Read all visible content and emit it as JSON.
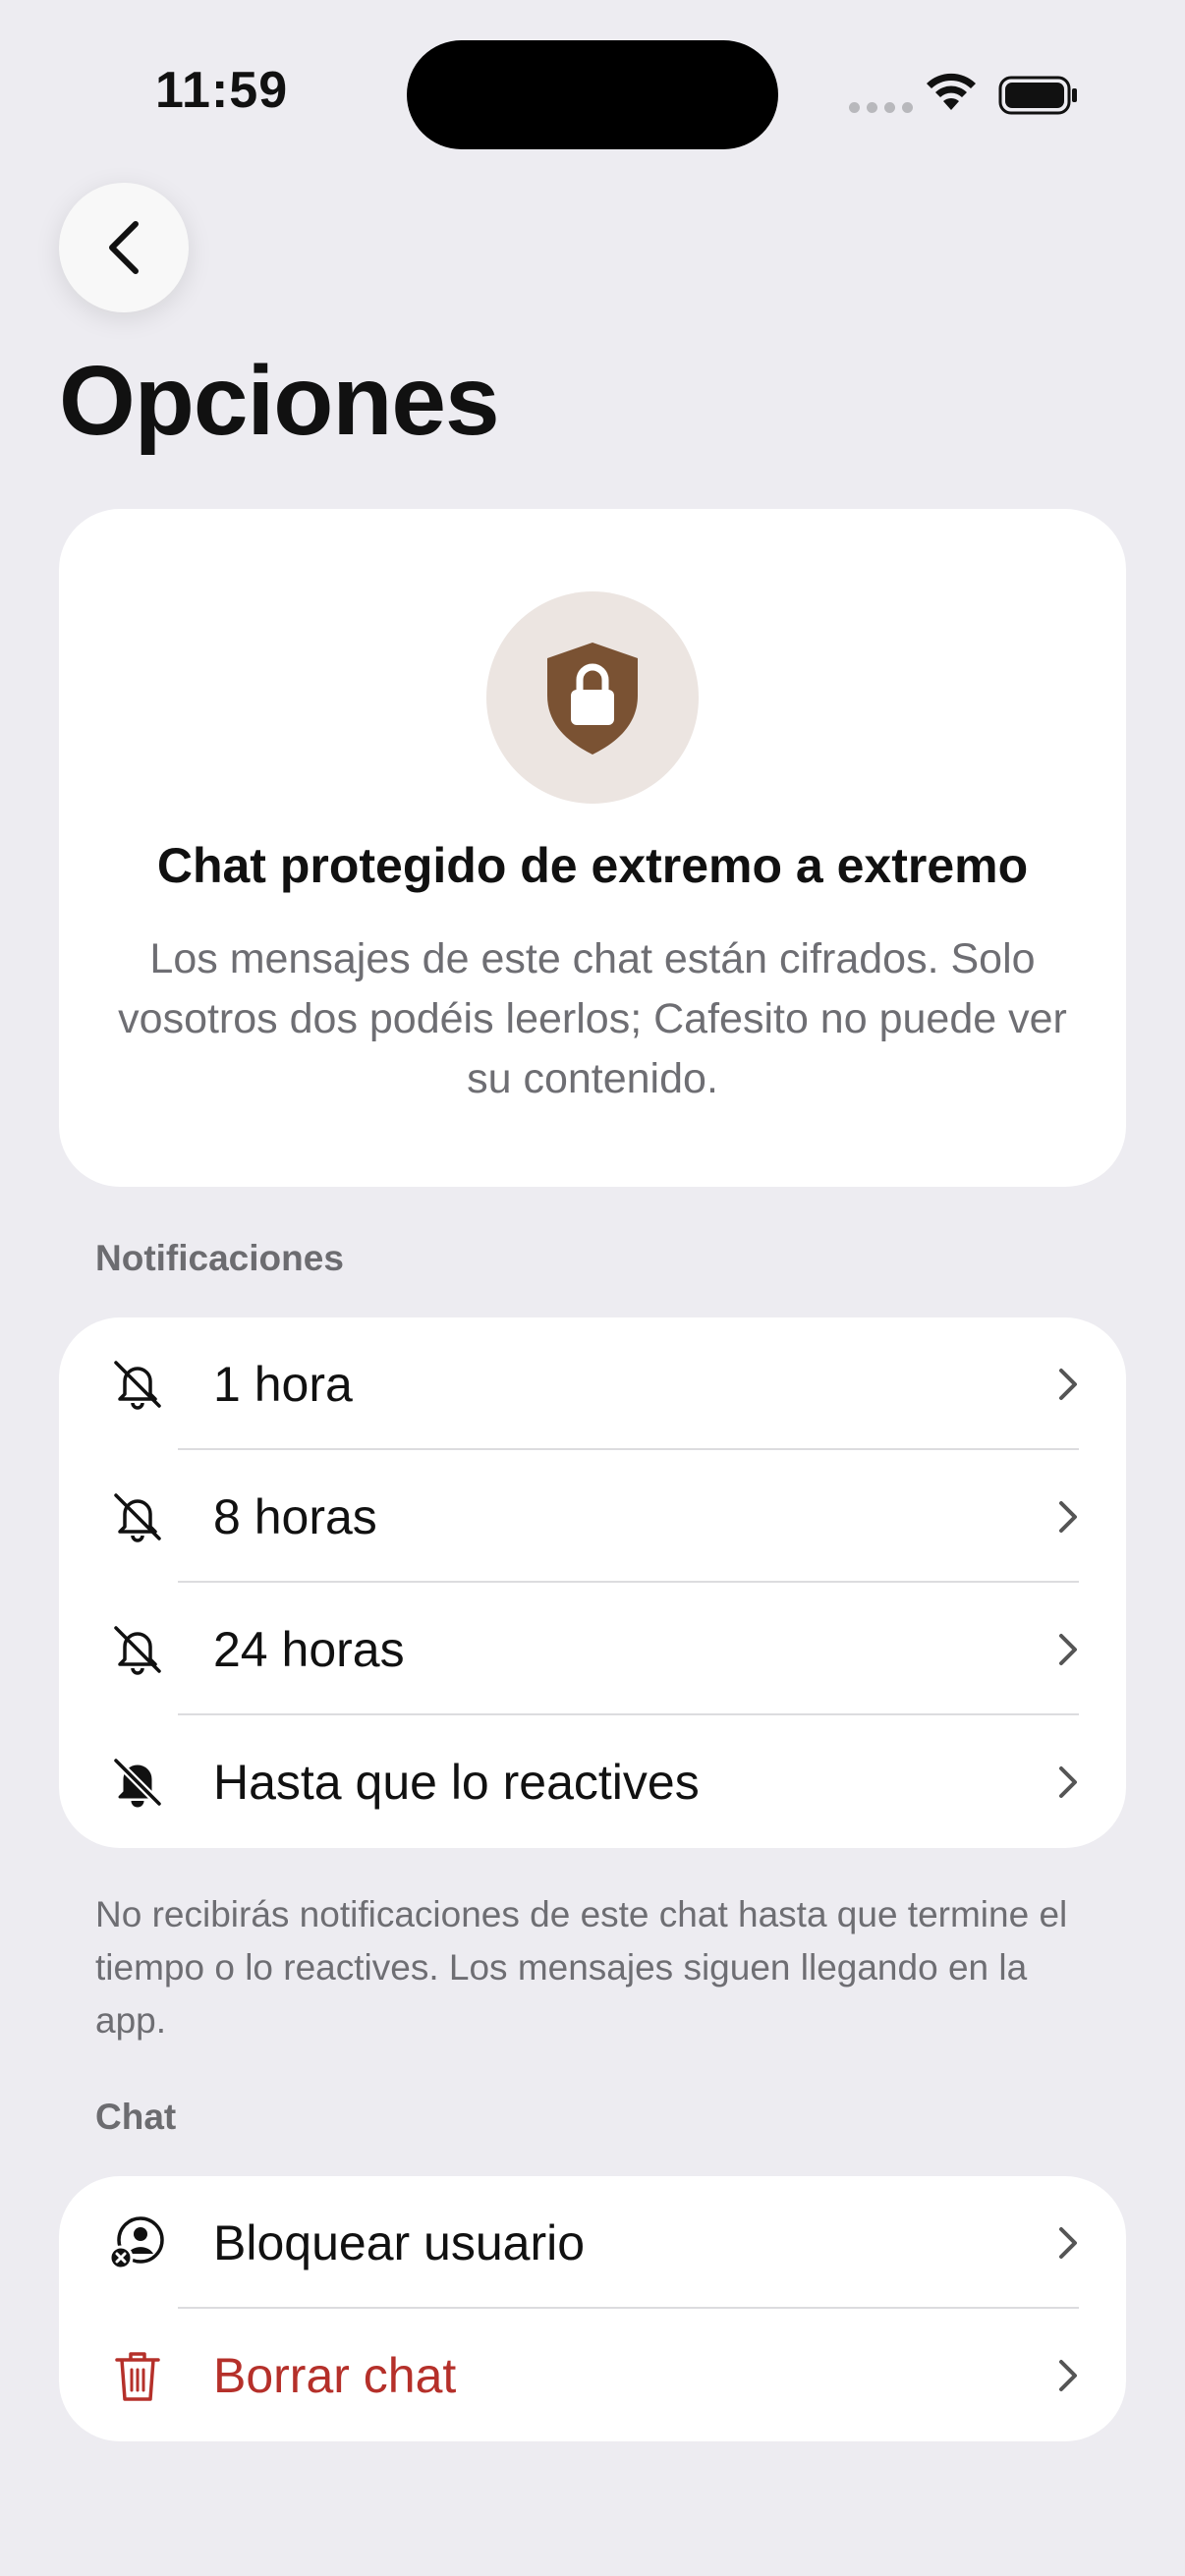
{
  "status_bar": {
    "time": "11:59"
  },
  "header": {
    "title": "Opciones"
  },
  "e2e_card": {
    "title": "Chat protegido de extremo a extremo",
    "body": "Los mensajes de este chat están cifrados. Solo vosotros dos podéis leerlos; Cafesito no puede ver su contenido.",
    "accent_color": "#7A5233"
  },
  "notifications": {
    "section_label": "Notificaciones",
    "items": [
      {
        "label": "1 hora",
        "icon": "bell-slash-outline-icon"
      },
      {
        "label": "8 horas",
        "icon": "bell-slash-outline-icon"
      },
      {
        "label": "24 horas",
        "icon": "bell-slash-outline-icon"
      },
      {
        "label": "Hasta que lo reactives",
        "icon": "bell-slash-filled-icon"
      }
    ],
    "footnote": "No recibirás notificaciones de este chat hasta que termine el tiempo o lo reactives. Los mensajes siguen llegando en la app."
  },
  "chat": {
    "section_label": "Chat",
    "items": [
      {
        "label": "Bloquear usuario",
        "icon": "block-user-icon"
      },
      {
        "label": "Borrar chat",
        "icon": "trash-icon",
        "color": "#B5302A"
      }
    ]
  }
}
